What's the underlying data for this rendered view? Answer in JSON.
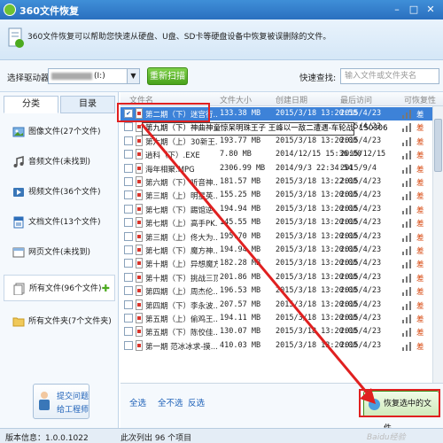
{
  "window": {
    "title": "360文件恢复"
  },
  "info": {
    "description": "360文件恢复可以帮助您快速从硬盘、U盘、SD卡等硬盘设备中恢复被误删除的文件。"
  },
  "toolbar": {
    "drive_label": "选择驱动器:",
    "drive_value": "(I:)",
    "rescan_label": "重新扫描",
    "search_label": "快速查找:",
    "search_placeholder": "输入文件或文件夹名"
  },
  "sidebar": {
    "tabs": [
      {
        "label": "分类"
      },
      {
        "label": "目录"
      }
    ],
    "items": [
      {
        "label": "图像文件(27个文件)",
        "icon": "image-file-icon"
      },
      {
        "label": "音频文件(未找到)",
        "icon": "music-note-icon"
      },
      {
        "label": "视频文件(36个文件)",
        "icon": "video-file-icon"
      },
      {
        "label": "文档文件(13个文件)",
        "icon": "document-file-icon"
      },
      {
        "label": "网页文件(未找到)",
        "icon": "web-file-icon"
      },
      {
        "label": "所有文件(96个文件)",
        "icon": "all-files-icon"
      },
      {
        "label": "所有文件夹(7个文件夹)",
        "icon": "folder-icon"
      }
    ],
    "help": {
      "line1": "提交问题",
      "line2": "给工程师"
    }
  },
  "filelist": {
    "columns": [
      "文件名",
      "文件大小",
      "创建日期",
      "最后访问",
      "可恢复性"
    ],
    "rows": [
      {
        "name": "第二期（下）迷宫行...",
        "size": "133.38 MB",
        "created": "2015/3/18 13:20:58",
        "accessed": "2015/4/23",
        "quality": "差",
        "checked": true,
        "selected": true
      },
      {
        "name": "第九期（下）",
        "size": "",
        "created": "",
        "accessed": "2015/4/23",
        "quality": "差",
        "checked": false,
        "selected": false
      },
      {
        "name": "第六期（上）30新王...",
        "size": "193.77 MB",
        "created": "2015/3/18 13:20:00",
        "accessed": "2015/4/23",
        "quality": "差",
        "checked": false,
        "selected": false
      },
      {
        "name": "逍科（下）.EXE",
        "size": "7.80 MB",
        "created": "2014/12/15 15:36:00",
        "accessed": "2015/12/15",
        "quality": "差",
        "checked": false,
        "selected": false
      },
      {
        "name": "海年相聚.MPG",
        "size": "2306.99 MB",
        "created": "2014/9/3 22:34:54",
        "accessed": "2015/9/4",
        "quality": "差",
        "checked": false,
        "selected": false
      },
      {
        "name": "第六期（下）听音神...",
        "size": "181.57 MB",
        "created": "2015/3/18 13:22:00",
        "accessed": "2015/4/23",
        "quality": "差",
        "checked": false,
        "selected": false
      },
      {
        "name": "第三期（上）明星英...",
        "size": "155.25 MB",
        "created": "2015/3/18 13:20:00",
        "accessed": "2015/4/23",
        "quality": "差",
        "checked": false,
        "selected": false
      },
      {
        "name": "第七期（下）踢馆逆...",
        "size": "194.94 MB",
        "created": "2015/3/18 13:20:00",
        "accessed": "2015/4/23",
        "quality": "差",
        "checked": false,
        "selected": false
      },
      {
        "name": "第七期（上）高手PK...",
        "size": "145.55 MB",
        "created": "2015/3/18 13:20:00",
        "accessed": "2015/4/23",
        "quality": "差",
        "checked": false,
        "selected": false
      },
      {
        "name": "第三期（上）佟大为...",
        "size": "195.70 MB",
        "created": "2015/3/18 13:20:00",
        "accessed": "2015/4/23",
        "quality": "差",
        "checked": false,
        "selected": false
      },
      {
        "name": "第七期（下）魔方神...",
        "size": "194.94 MB",
        "created": "2015/3/18 13:20:00",
        "accessed": "2015/4/23",
        "quality": "差",
        "checked": false,
        "selected": false
      },
      {
        "name": "第十期（上）异想魔方...",
        "size": "182.28 MB",
        "created": "2015/3/18 13:20:00",
        "accessed": "2015/4/23",
        "quality": "差",
        "checked": false,
        "selected": false
      },
      {
        "name": "第十期（下）挑战三顶...",
        "size": "201.86 MB",
        "created": "2015/3/18 13:20:00",
        "accessed": "2015/4/23",
        "quality": "差",
        "checked": false,
        "selected": false
      },
      {
        "name": "第四期（上）周杰伦...",
        "size": "196.53 MB",
        "created": "2015/3/18 13:20:00",
        "accessed": "2015/4/23",
        "quality": "差",
        "checked": false,
        "selected": false
      },
      {
        "name": "第四期（下）李永波...",
        "size": "207.57 MB",
        "created": "2015/3/18 13:20:00",
        "accessed": "2015/4/23",
        "quality": "差",
        "checked": false,
        "selected": false
      },
      {
        "name": "第五期（上）偷鸡王...",
        "size": "194.11 MB",
        "created": "2015/3/18 13:20:00",
        "accessed": "2015/4/23",
        "quality": "差",
        "checked": false,
        "selected": false
      },
      {
        "name": "第五期（下）陈佼佳...",
        "size": "130.07 MB",
        "created": "2015/3/18 13:20:00",
        "accessed": "2015/4/23",
        "quality": "差",
        "checked": false,
        "selected": false
      },
      {
        "name": "第一期 范冰冰求-摸...",
        "size": "410.03 MB",
        "created": "2015/3/18 13:20:00",
        "accessed": "2015/4/23",
        "quality": "差",
        "checked": false,
        "selected": false
      }
    ],
    "tooltip": "第九期（下）神曲神童惊呆明珠王子 王峰以一敌二遭遇-车轮战- 150306"
  },
  "actions": {
    "select_all": "全选",
    "select_none": "全不选",
    "invert": "反选",
    "recover": "恢复选中的文件"
  },
  "status": {
    "version": "版本信息：1.0.0.1022",
    "count": "此次列出 96 个项目"
  },
  "watermark": "Baidu经验",
  "colors": {
    "accent_blue": "#2a6fbf",
    "selection_blue": "#3d82d8",
    "rescan_green": "#48a21a",
    "annotation_red": "#e02020",
    "quality_orange": "#d84a10"
  }
}
